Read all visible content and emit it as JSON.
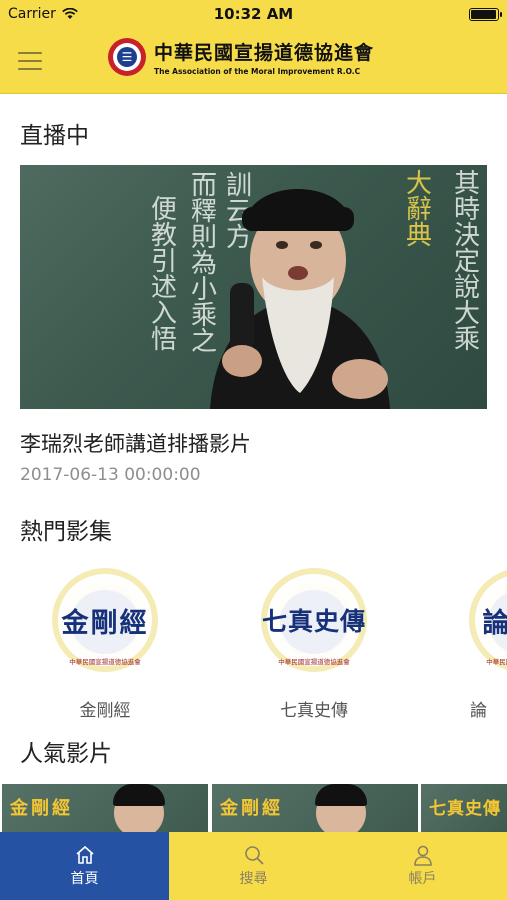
{
  "status_bar": {
    "carrier": "Carrier",
    "time": "10:32 AM",
    "battery_level": 0.95
  },
  "header": {
    "logo_zh": "中華民國宣揚道德協進會",
    "logo_en": "The Association of the Moral Improvement R.O.C",
    "logo_glyph": "☰"
  },
  "live": {
    "section_title": "直播中",
    "video_title": "李瑞烈老師講道排播影片",
    "video_date": "2017-06-13 00:00:00",
    "board_columns": [
      "訓云方",
      "而釋則為小乘之",
      "便教引述入悟",
      "其時決定說大乘"
    ],
    "board_highlight": "大辭典"
  },
  "popular_albums": {
    "section_title": "熱門影集",
    "org_caption": "中華民國宣揚道德協進會",
    "items": [
      {
        "cover_title": "金剛經",
        "label": "金剛經"
      },
      {
        "cover_title": "七真史傳",
        "label": "七真史傳"
      },
      {
        "cover_title": "論",
        "label": "論"
      }
    ]
  },
  "popular_videos": {
    "section_title": "人氣影片",
    "items": [
      {
        "cover_title": "金剛經"
      },
      {
        "cover_title": "金剛經"
      },
      {
        "cover_title": "七真史傳"
      }
    ]
  },
  "tab_bar": {
    "items": [
      {
        "label": "首頁",
        "icon": "home-icon",
        "active": true
      },
      {
        "label": "搜尋",
        "icon": "search-icon",
        "active": false
      },
      {
        "label": "帳戶",
        "icon": "account-icon",
        "active": false
      }
    ]
  },
  "colors": {
    "brand_yellow": "#f7dc4a",
    "active_tab": "#2552a3",
    "title_blue": "#16317a"
  }
}
